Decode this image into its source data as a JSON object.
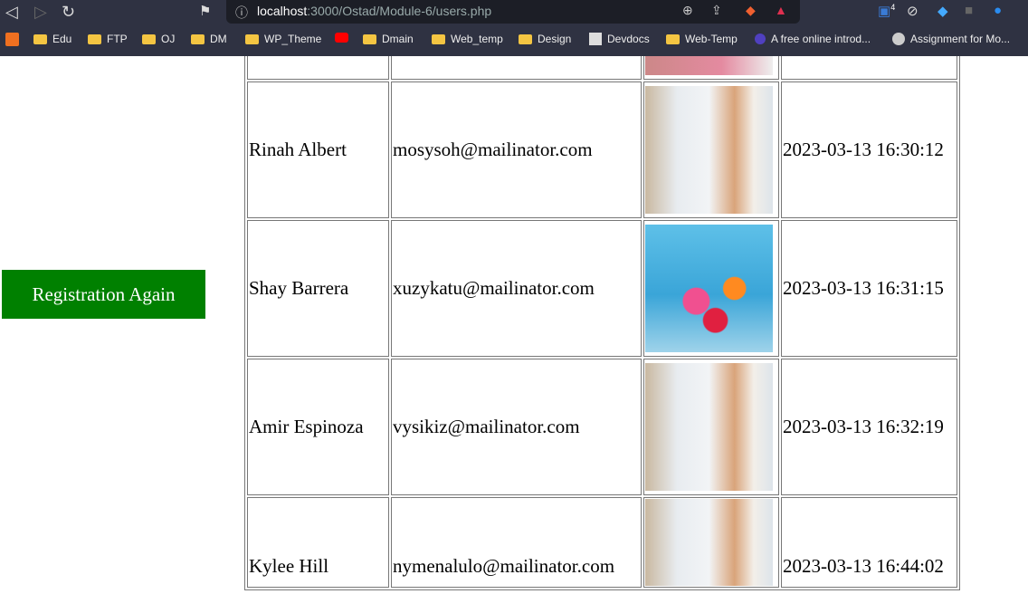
{
  "browser": {
    "url_host": "localhost",
    "url_rest": ":3000/Ostad/Module-6/users.php",
    "bookmarks": [
      "Edu",
      "FTP",
      "OJ",
      "DM",
      "WP_Theme",
      "Dmain",
      "Web_temp",
      "Design",
      "Devdocs",
      "Web-Temp",
      "A free online introd...",
      "Assignment for Mo..."
    ],
    "extension_badge": "4"
  },
  "page": {
    "button_label": "Registration Again",
    "rows": [
      {
        "name": "",
        "email": "",
        "image": "pink",
        "date": ""
      },
      {
        "name": "Rinah Albert",
        "email": "mosysoh@mailinator.com",
        "image": "doctor",
        "date": "2023-03-13 16:30:12"
      },
      {
        "name": "Shay Barrera",
        "email": "xuzykatu@mailinator.com",
        "image": "pills",
        "date": "2023-03-13 16:31:15"
      },
      {
        "name": "Amir Espinoza",
        "email": "vysikiz@mailinator.com",
        "image": "doctor",
        "date": "2023-03-13 16:32:19"
      },
      {
        "name": "Kylee Hill",
        "email": "nymenalulo@mailinator.com",
        "image": "doctor",
        "date": "2023-03-13 16:44:02"
      }
    ]
  }
}
